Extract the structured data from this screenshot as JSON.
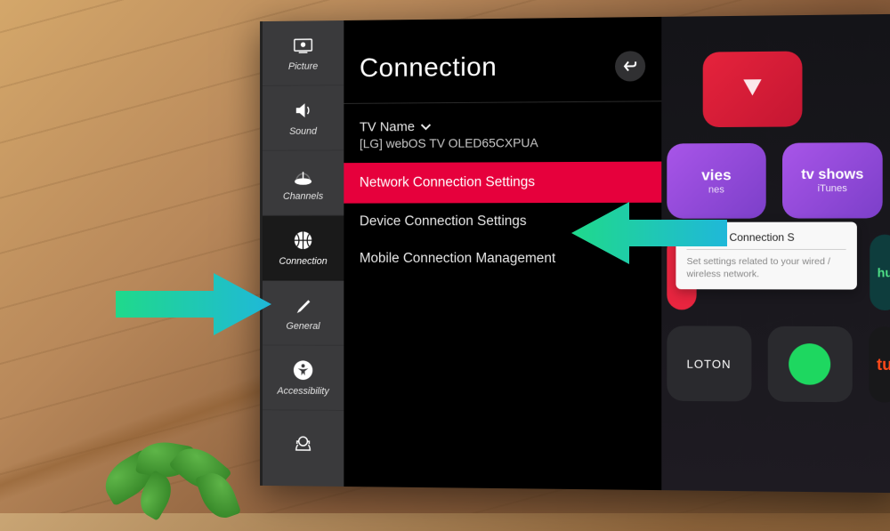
{
  "sidebar": {
    "items": [
      {
        "label": "Picture",
        "icon": "picture-icon"
      },
      {
        "label": "Sound",
        "icon": "sound-icon"
      },
      {
        "label": "Channels",
        "icon": "channels-icon"
      },
      {
        "label": "Connection",
        "icon": "connection-icon",
        "selected": true
      },
      {
        "label": "General",
        "icon": "general-icon"
      },
      {
        "label": "Accessibility",
        "icon": "accessibility-icon"
      },
      {
        "label": "Support",
        "icon": "support-icon"
      }
    ]
  },
  "panel": {
    "title": "Connection",
    "tv_name_label": "TV Name",
    "tv_name_value": "[LG] webOS TV OLED65CXPUA",
    "items": [
      {
        "label": "Network Connection Settings",
        "highlighted": true
      },
      {
        "label": "Device Connection Settings"
      },
      {
        "label": "Mobile Connection Management"
      }
    ]
  },
  "popup": {
    "title": "Network Connection S",
    "description": "Set settings related to your wired / wireless network."
  },
  "apps": {
    "movies": "vies",
    "movies_sub": "nes",
    "tvshows": "tv shows",
    "tvshows_sub": "iTunes",
    "loton": "LOTON",
    "hu": "hu",
    "tu": "tu"
  }
}
